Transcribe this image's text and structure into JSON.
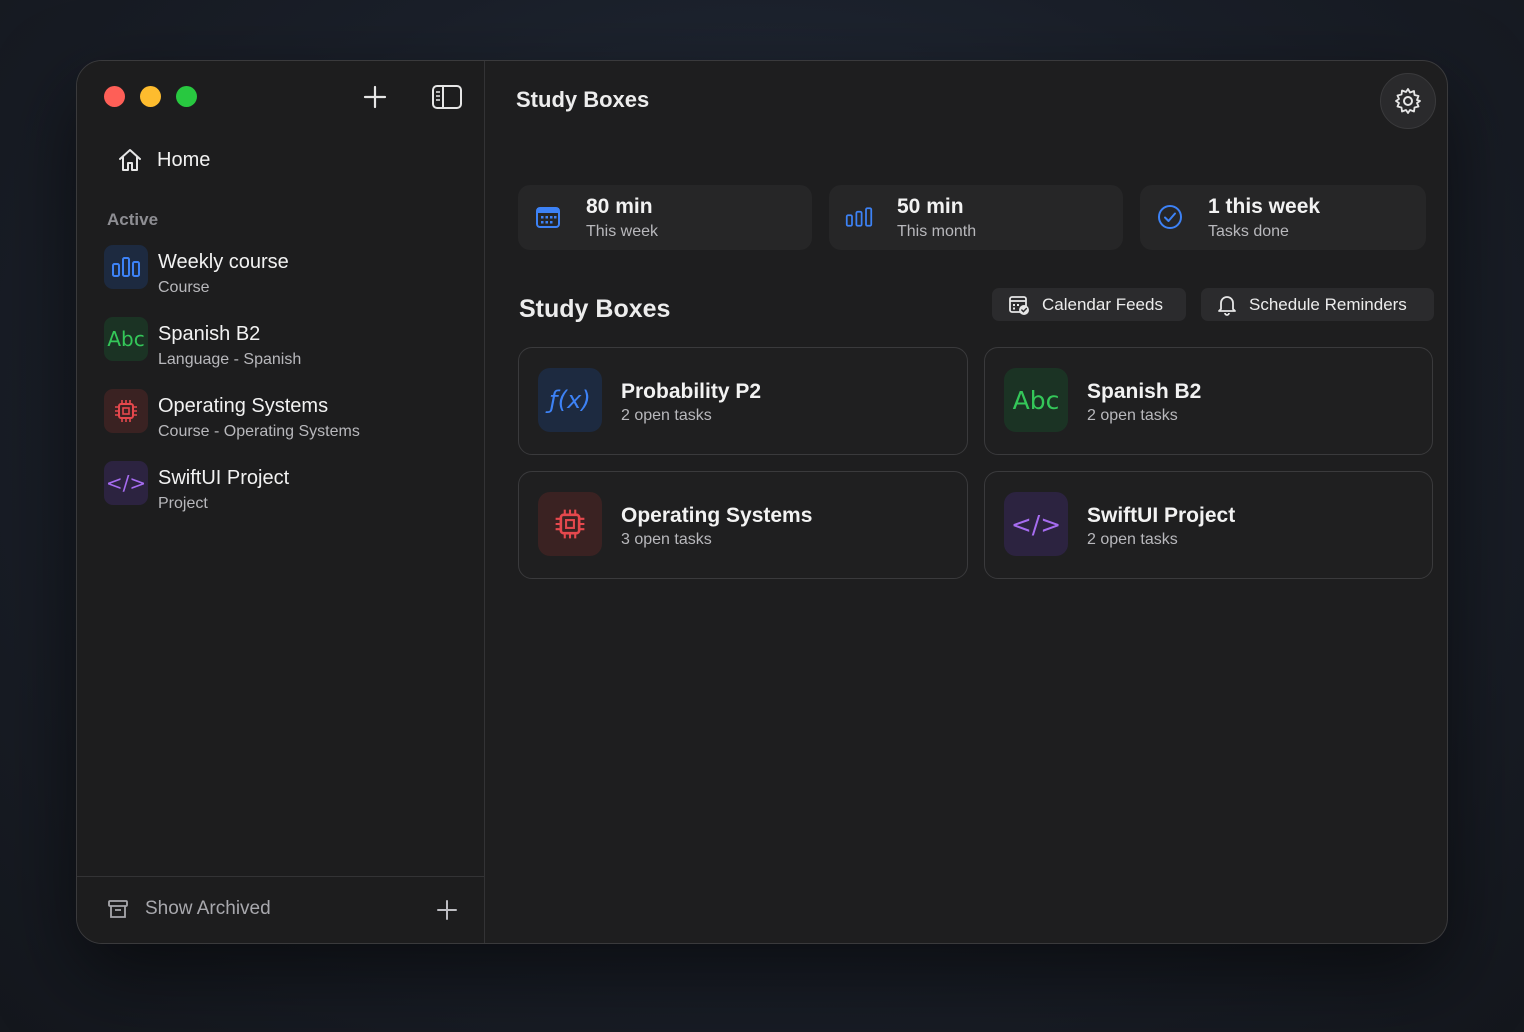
{
  "window": {
    "title": "Study Boxes"
  },
  "sidebar": {
    "home_label": "Home",
    "section_label": "Active",
    "items": [
      {
        "title": "Weekly course",
        "subtitle": "Course",
        "icon": "bar-chart-icon",
        "color": "#3d82f6"
      },
      {
        "title": "Spanish B2",
        "subtitle": "Language - Spanish",
        "icon": "abc-icon",
        "icon_text": "Abc",
        "color": "#34c759"
      },
      {
        "title": "Operating Systems",
        "subtitle": "Course - Operating Systems",
        "icon": "cpu-icon",
        "color": "#e5484d"
      },
      {
        "title": "SwiftUI Project",
        "subtitle": "Project",
        "icon": "code-icon",
        "icon_text": "</>",
        "color": "#a66cf0"
      }
    ],
    "footer": {
      "archived_label": "Show Archived"
    }
  },
  "stats": [
    {
      "value": "80 min",
      "label": "This week",
      "icon": "calendar-icon"
    },
    {
      "value": "50 min",
      "label": "This month",
      "icon": "bar-chart-icon"
    },
    {
      "value": "1 this week",
      "label": "Tasks done",
      "icon": "checkmark-circle-icon"
    }
  ],
  "boxes_section": {
    "title": "Study Boxes",
    "calendar_feeds_label": "Calendar Feeds",
    "schedule_reminders_label": "Schedule Reminders"
  },
  "boxes": [
    {
      "title": "Probability P2",
      "subtitle": "2 open tasks",
      "icon": "function-icon",
      "icon_text": "ƒ(x)",
      "color": "#3d82f6"
    },
    {
      "title": "Spanish B2",
      "subtitle": "2 open tasks",
      "icon": "abc-icon",
      "icon_text": "Abc",
      "color": "#34c759"
    },
    {
      "title": "Operating Systems",
      "subtitle": "3 open tasks",
      "icon": "cpu-icon",
      "color": "#e5484d"
    },
    {
      "title": "SwiftUI Project",
      "subtitle": "2 open tasks",
      "icon": "code-icon",
      "icon_text": "</>",
      "color": "#a66cf0"
    }
  ],
  "colors": {
    "accent_blue": "#3d82f6",
    "green": "#34c759",
    "red": "#e5484d",
    "purple": "#a66cf0"
  }
}
